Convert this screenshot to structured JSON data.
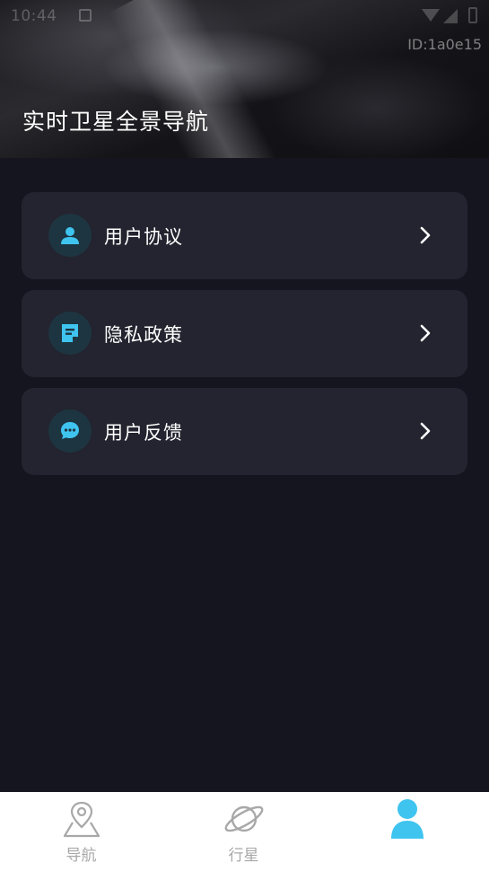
{
  "status_bar": {
    "time": "10:44",
    "icons": [
      "notification-icon",
      "wifi-icon",
      "signal-icon",
      "battery-icon"
    ]
  },
  "header": {
    "user_id": "ID:1a0e15",
    "title": "实时卫星全景导航"
  },
  "menu": {
    "items": [
      {
        "label": "用户协议",
        "icon": "user-icon"
      },
      {
        "label": "隐私政策",
        "icon": "document-icon"
      },
      {
        "label": "用户反馈",
        "icon": "chat-icon"
      }
    ]
  },
  "bottom_nav": {
    "items": [
      {
        "label": "导航",
        "icon": "location-pin-icon",
        "active": false
      },
      {
        "label": "行星",
        "icon": "planet-icon",
        "active": false
      },
      {
        "label": "",
        "icon": "profile-icon",
        "active": true
      }
    ]
  },
  "colors": {
    "background": "#14151f",
    "card": "#23242f",
    "accent": "#3fc4ef",
    "icon_bg": "#1d3541",
    "nav_inactive": "#a8a8a8"
  }
}
